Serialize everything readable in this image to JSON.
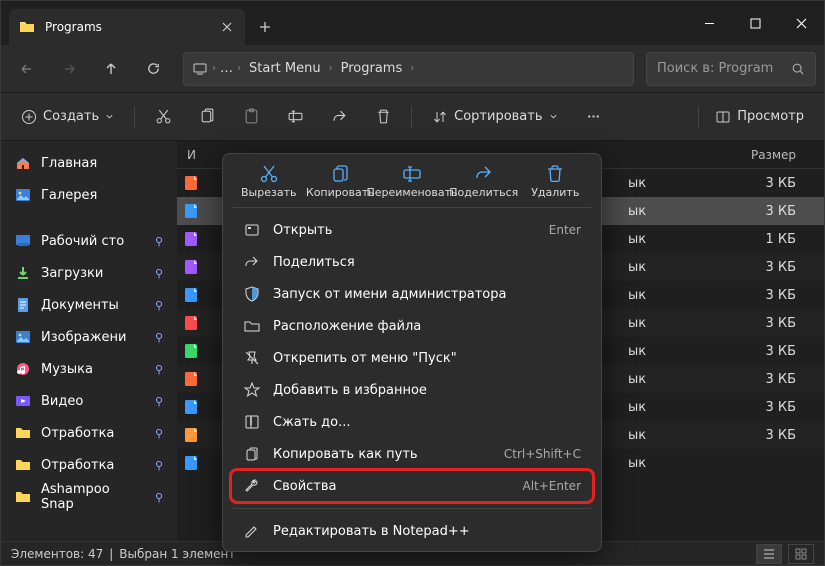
{
  "titlebar": {
    "tab_title": "Programs"
  },
  "addressbar": {
    "crumbs": [
      "Start Menu",
      "Programs"
    ],
    "ellipsis": "…"
  },
  "search": {
    "placeholder": "Поиск в: Program"
  },
  "toolbar": {
    "create": "Создать",
    "sort": "Сортировать",
    "view": "Просмотр"
  },
  "sidebar": {
    "home": "Главная",
    "gallery": "Галерея",
    "items": [
      {
        "label": "Рабочий сто"
      },
      {
        "label": "Загрузки"
      },
      {
        "label": "Документы"
      },
      {
        "label": "Изображени"
      },
      {
        "label": "Музыка"
      },
      {
        "label": "Видео"
      },
      {
        "label": "Отработка"
      },
      {
        "label": "Отработка"
      },
      {
        "label": "Ashampoo Snap"
      }
    ]
  },
  "columns": {
    "name": "И",
    "type": "",
    "size": "Размер"
  },
  "rows": [
    {
      "type": "ык",
      "size": "3 КБ"
    },
    {
      "type": "ык",
      "size": "3 КБ",
      "selected": true
    },
    {
      "type": "ык",
      "size": "1 КБ"
    },
    {
      "type": "ык",
      "size": "3 КБ"
    },
    {
      "type": "ык",
      "size": "3 КБ"
    },
    {
      "type": "ык",
      "size": "3 КБ"
    },
    {
      "type": "ык",
      "size": "3 КБ"
    },
    {
      "type": "ык",
      "size": "3 КБ"
    },
    {
      "type": "ык",
      "size": "3 КБ"
    },
    {
      "type": "ык",
      "size": "3 КБ"
    },
    {
      "type": "ык",
      "size": ""
    }
  ],
  "status": {
    "count": "Элементов: 47",
    "selected": "Выбран 1 элемент"
  },
  "ctx": {
    "actions": [
      {
        "label": "Вырезать",
        "icon": "cut"
      },
      {
        "label": "Копировать",
        "icon": "copy"
      },
      {
        "label": "Переименовать",
        "icon": "rename"
      },
      {
        "label": "Поделиться",
        "icon": "share"
      },
      {
        "label": "Удалить",
        "icon": "delete"
      }
    ],
    "items": [
      {
        "label": "Открыть",
        "key": "Enter",
        "icon": "open"
      },
      {
        "label": "Поделиться",
        "icon": "share2"
      },
      {
        "label": "Запуск от имени администратора",
        "icon": "shield"
      },
      {
        "label": "Расположение файла",
        "icon": "folder"
      },
      {
        "label": "Открепить от меню \"Пуск\"",
        "icon": "unpin"
      },
      {
        "label": "Добавить в избранное",
        "icon": "star"
      },
      {
        "label": "Сжать до...",
        "icon": "compress"
      },
      {
        "label": "Копировать как путь",
        "key": "Ctrl+Shift+C",
        "icon": "copypath"
      },
      {
        "label": "Свойства",
        "key": "Alt+Enter",
        "icon": "wrench",
        "highlight": true
      },
      {
        "label": "Редактировать в Notepad++",
        "icon": "edit",
        "sepBefore": true
      }
    ]
  }
}
